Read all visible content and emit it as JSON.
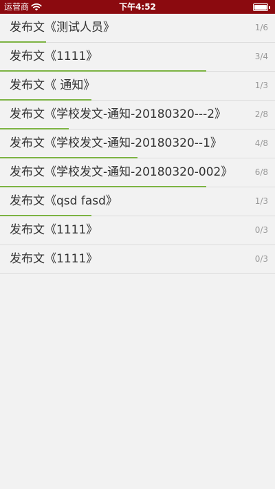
{
  "status_bar": {
    "carrier": "运营商",
    "time": "下午4:52",
    "wifi_icon": "wifi-icon",
    "battery_icon": "battery-icon"
  },
  "colors": {
    "status_bar": "#8b0a0f",
    "progress": "#7cb342",
    "background": "#f2f2f2"
  },
  "documents": [
    {
      "title": "发布文《测试人员》",
      "count": "1/6",
      "progress": 0.1667
    },
    {
      "title": "发布文《1111》",
      "count": "3/4",
      "progress": 0.75
    },
    {
      "title": "发布文《 通知》",
      "count": "1/3",
      "progress": 0.3333
    },
    {
      "title": "发布文《学校发文-通知-20180320---2》",
      "count": "2/8",
      "progress": 0.25
    },
    {
      "title": "发布文《学校发文-通知-20180320--1》",
      "count": "4/8",
      "progress": 0.5
    },
    {
      "title": "发布文《学校发文-通知-20180320-002》",
      "count": "6/8",
      "progress": 0.75
    },
    {
      "title": "发布文《qsd fasd》",
      "count": "1/3",
      "progress": 0.3333
    },
    {
      "title": "发布文《1111》",
      "count": "0/3",
      "progress": 0
    },
    {
      "title": "发布文《1111》",
      "count": "0/3",
      "progress": 0
    }
  ]
}
